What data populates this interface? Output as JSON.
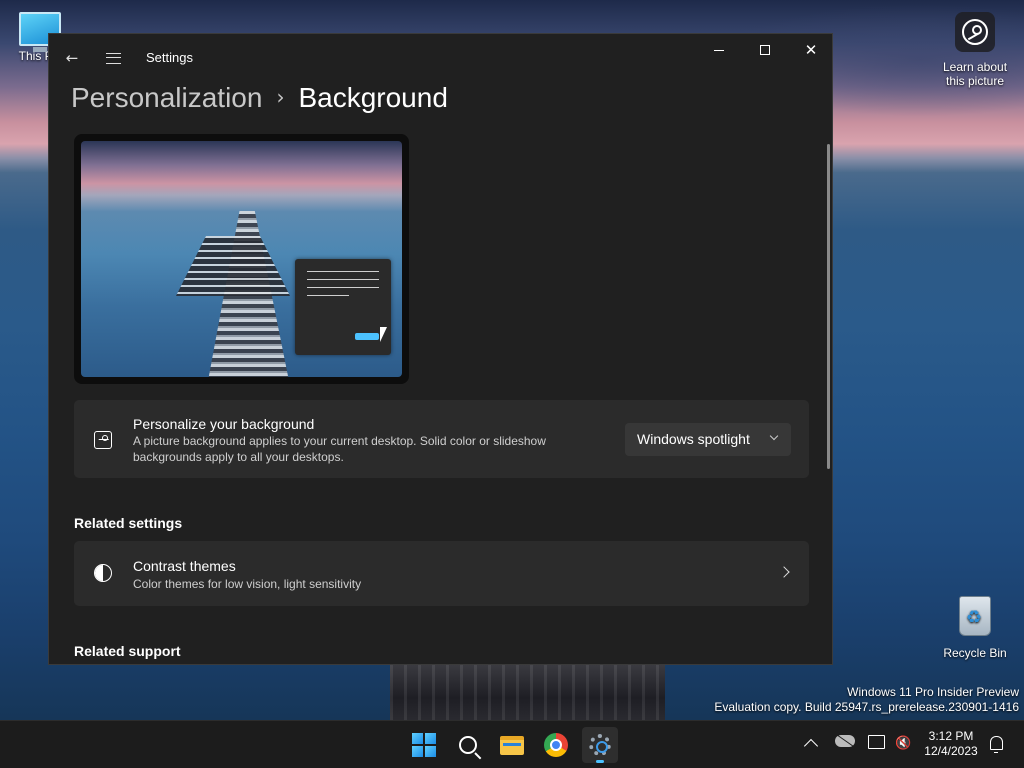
{
  "desktop": {
    "icons": {
      "this_pc": "This PC",
      "learn_line1": "Learn about",
      "learn_line2": "this picture",
      "recycle_bin": "Recycle Bin"
    },
    "watermark": {
      "line1": "Windows 11 Pro Insider Preview",
      "line2": "Evaluation copy. Build 25947.rs_prerelease.230901-1416"
    }
  },
  "window": {
    "title": "Settings",
    "controls": {
      "back": "←",
      "minimize": "minimize",
      "maximize": "maximize",
      "close": "✕"
    },
    "breadcrumb": {
      "parent": "Personalization",
      "separator": "›",
      "current": "Background"
    }
  },
  "background_card": {
    "icon": "picture-icon",
    "title": "Personalize your background",
    "description": "A picture background applies to your current desktop. Solid color or slideshow backgrounds apply to all your desktops.",
    "dropdown_value": "Windows spotlight"
  },
  "related_settings": {
    "heading": "Related settings",
    "contrast": {
      "icon": "contrast-icon",
      "title": "Contrast themes",
      "description": "Color themes for low vision, light sensitivity"
    }
  },
  "related_support": {
    "heading": "Related support"
  },
  "taskbar": {
    "apps": [
      "start",
      "search",
      "file-explorer",
      "chrome",
      "settings"
    ],
    "active_app": "settings",
    "time": "3:12 PM",
    "date": "12/4/2023"
  },
  "colors": {
    "window_bg": "#202020",
    "card_bg": "#2b2b2b",
    "accent": "#4cc2ff",
    "taskbar_bg": "#1c1c1c"
  }
}
